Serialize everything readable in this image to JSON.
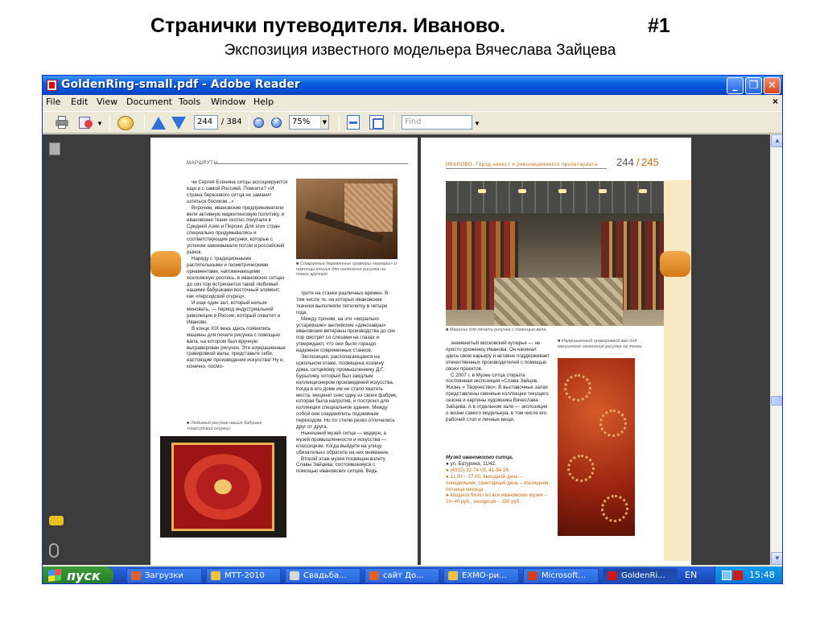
{
  "slide": {
    "title": "Странички путеводителя. Иваново.",
    "number": "#1",
    "subtitle": "Экспозиция известного модельера Вячеслава Зайцева"
  },
  "window": {
    "title": "GoldenRing-small.pdf - Adobe Reader",
    "minimize_icon": "minimize-icon",
    "maximize_icon": "restore-icon",
    "close_icon": "close-icon"
  },
  "menu": {
    "items": [
      "File",
      "Edit",
      "View",
      "Document",
      "Tools",
      "Window",
      "Help"
    ],
    "close_glyph": "×"
  },
  "toolbar": {
    "current_page": "244",
    "page_total": "/ 384",
    "zoom": "75%",
    "find_placeholder": "Find"
  },
  "page_left": {
    "running_head": "МАРШРУТЫ",
    "col1_paragraphs": [
      "чи Сергея Есенина ситцы ассоциируются еще и с самой Россией. Помните? «И страна березового ситца не заманит шляться босиком...»",
      "Впрочем, ивановские предприниматели вели активную маркетинговую политику, и ивановские ткани охотно покупали в Средней Азии и Персии. Для этих стран специально придумывались и соответствующие рисунки, которые с успехом завоевывали потом и российский рынок.",
      "Наряду с традиционными растительными и геометрическими орнаментами, напоминающими хохломскую роспись, в ивановских ситцах до сих пор встречается такой любимый нашими бабушками восточный элемент, как «персидский огурец».",
      "И еще один зал, который нельзя миновать, — период индустриальной революции в России, который охватил и Иваново.",
      "В конце XIX века здесь появились машины для печати рисунка с помощью вала, на котором был вручную выгравирован рисунок. Эти изукрашенные гравировкой валы, представьте себе, настоящие произведения искусства! Ну и, конечно, посмо-"
    ],
    "caption_loom": "■ Старинные деревянные гравюры «манеры» и ножницы-клинья для нанесения рисунка на ткань вручную",
    "caption_carpet": "■ Любимый рисунок наших бабушек «персидский огурец»",
    "col2_paragraphs": [
      "трите на станки различных времен. В том числе те, на которых ивановские ткачихи выполняли пятилетку в четыре года.",
      "Между прочим, на эти «морально устаревшие» английские «динозавры» ивановские ветераны производства до сих пор смотрят со слезами на глазах и утверждают, что они были гораздо надежнее современных станков.",
      "Экспозиция, располагающаяся на цокольном этаже, посвящена хозяину дома, ситцевому промышленнику Д.Г. Бурылину, который был заядлым коллекционером произведений искусства. Когда в его доме им не стало хватать места, меценат снес одну из своих фабрик, которая была напротив, и построил для коллекции специальное здание. Между собой они соединялись подземным переходом. Но по стилю резко отличались друг от друга.",
      "Нынешний музей ситца — модерн, а музей промышленности и искусства — классицизм. Когда выйдете на улицу, обязательно обратите на них внимание.",
      "Второй этаж музея посвящен взлету Славы Зайцева, состоявшемуся с помощью ивановских ситцев. Ведь"
    ]
  },
  "page_right": {
    "running_head": "ИВАНОВО. Город невест и революционного пролетариата",
    "page_left_num": "244",
    "page_slash": "/",
    "page_right_num": "245",
    "caption_museum": "■ Машины для печати рисунка с помощью вала",
    "caption_roller": "■ Изукрашенный гравировкой вал для машинного нанесения рисунка на ткань",
    "col_paragraphs": [
      "знаменитый московский кутюрье — не просто уроженец Иванова. Он начинал здесь свою карьеру и активно поддерживает отечественных производителей с помощью своих проектов.",
      "С 2007 г. в Музее ситца открыта постоянная экспозиция «Слава Зайцев. Жизнь = Творчество». В выставочных залах представлены сменные коллекции текущего сезона и картины художника Вячеслава Зайцева. А в отдельном зале — экспозиция о жизни самого модельера, в том числе его рабочий стол и личные вещи."
    ],
    "museum_name": "Музей ивановского ситца,",
    "address": "ул. Батурина, 11/42.",
    "phone": "(4932) 32-74-05, 41-64-26.",
    "hours": "11.00 – 17.00, выходной день – понедельник, санитарный день – последняя пятница месяца.",
    "ticket": "входной билет во все ивановские музеи – 10–40 руб., экскурсия – 150 руб."
  },
  "taskbar": {
    "start_label": "пуск",
    "tasks": [
      {
        "label": "Загрузки",
        "color": "#e0602a"
      },
      {
        "label": "МТТ-2010",
        "color": "#f0c040"
      },
      {
        "label": "Свадьба...",
        "color": "#d8d8d8"
      },
      {
        "label": "сайт До...",
        "color": "#e0602a"
      },
      {
        "label": "ЕХМО-ри...",
        "color": "#f0c040"
      },
      {
        "label": "Microsoft...",
        "color": "#d04020"
      },
      {
        "label": "GoldenRi...",
        "color": "#d01818"
      }
    ],
    "lang": "EN",
    "clock": "15:48"
  }
}
